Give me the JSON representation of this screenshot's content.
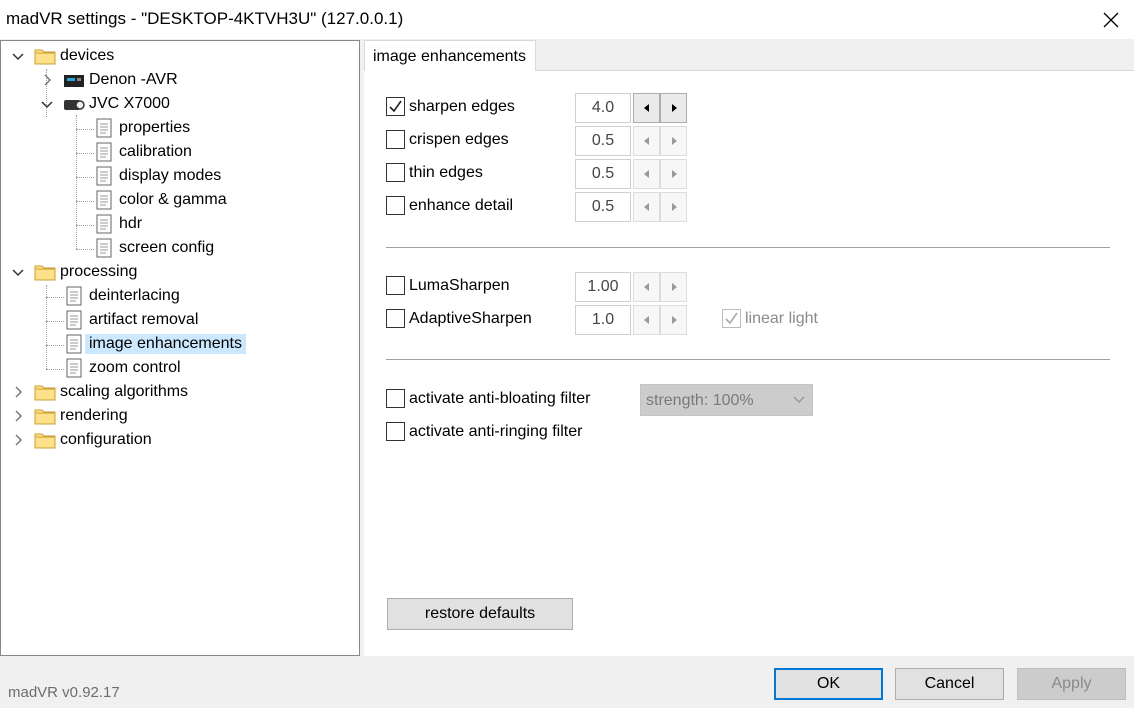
{
  "window": {
    "title": "madVR settings - \"DESKTOP-4KTVH3U\" (127.0.0.1)",
    "version": "madVR v0.92.17"
  },
  "tree": {
    "devices": "devices",
    "denon": "Denon -AVR",
    "jvc": "JVC X7000",
    "properties": "properties",
    "calibration": "calibration",
    "display_modes": "display modes",
    "color_gamma": "color & gamma",
    "hdr": "hdr",
    "screen_config": "screen config",
    "processing": "processing",
    "deinterlacing": "deinterlacing",
    "artifact_removal": "artifact removal",
    "image_enhancements": "image enhancements",
    "zoom_control": "zoom control",
    "scaling_algorithms": "scaling algorithms",
    "rendering": "rendering",
    "configuration": "configuration"
  },
  "tab": {
    "label": "image enhancements"
  },
  "options": {
    "sharpen_edges": {
      "label": "sharpen edges",
      "value": "4.0",
      "checked": true
    },
    "crispen_edges": {
      "label": "crispen edges",
      "value": "0.5",
      "checked": false
    },
    "thin_edges": {
      "label": "thin edges",
      "value": "0.5",
      "checked": false
    },
    "enhance_detail": {
      "label": "enhance detail",
      "value": "0.5",
      "checked": false
    },
    "lumasharpen": {
      "label": "LumaSharpen",
      "value": "1.00",
      "checked": false
    },
    "adaptivesharpen": {
      "label": "AdaptiveSharpen",
      "value": "1.0",
      "checked": false
    },
    "linear_light": {
      "label": "linear light",
      "checked": true,
      "disabled": true
    },
    "anti_bloating": {
      "label": "activate anti-bloating filter",
      "checked": false
    },
    "anti_ringing": {
      "label": "activate anti-ringing filter",
      "checked": false
    }
  },
  "strength_dropdown": {
    "value": "strength: 100%"
  },
  "buttons": {
    "restore_defaults": "restore defaults",
    "ok": "OK",
    "cancel": "Cancel",
    "apply": "Apply"
  }
}
